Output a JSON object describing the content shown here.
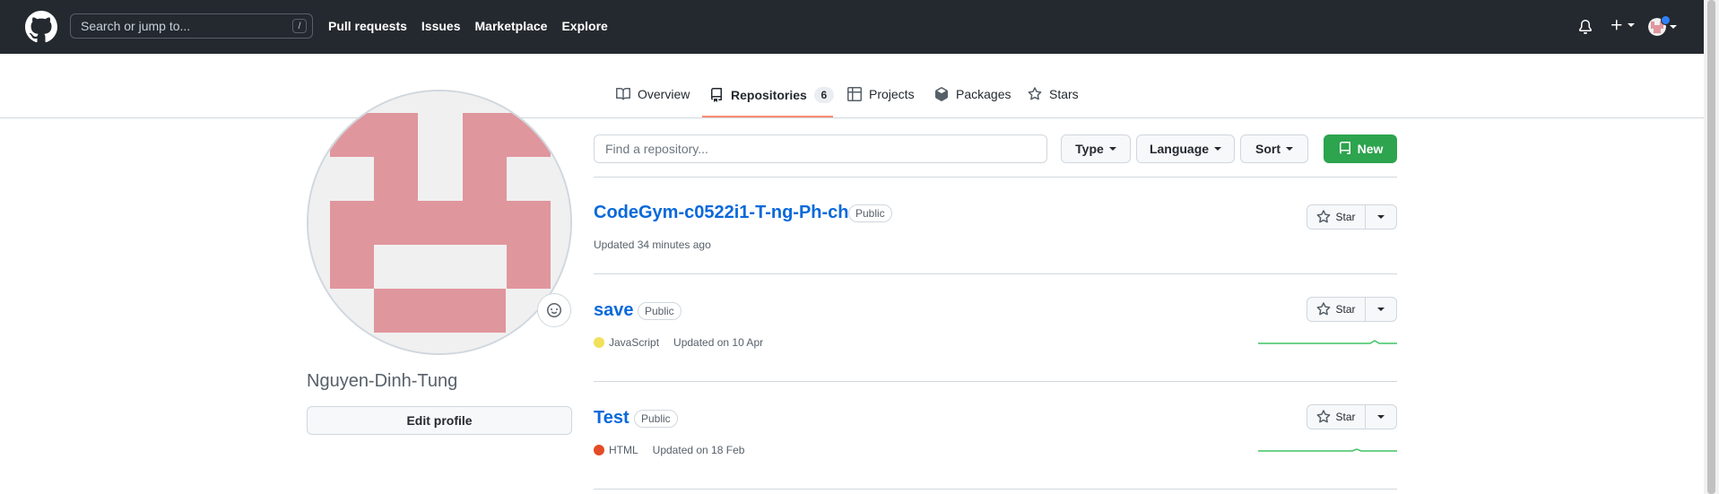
{
  "header": {
    "search_placeholder": "Search or jump to...",
    "search_key": "/",
    "nav": [
      "Pull requests",
      "Issues",
      "Marketplace",
      "Explore"
    ]
  },
  "tabs": {
    "overview": "Overview",
    "repositories": "Repositories",
    "repositories_count": "6",
    "projects": "Projects",
    "packages": "Packages",
    "stars": "Stars"
  },
  "profile": {
    "username": "Nguyen-Dinh-Tung",
    "edit_label": "Edit profile"
  },
  "filters": {
    "find_placeholder": "Find a repository...",
    "type": "Type",
    "language": "Language",
    "sort": "Sort",
    "new": "New"
  },
  "repos": [
    {
      "name": "CodeGym-c0522i1-T-ng-Ph-ch",
      "visibility": "Public",
      "language": "",
      "language_color": "",
      "updated": "Updated 34 minutes ago",
      "star_label": "Star"
    },
    {
      "name": "save",
      "visibility": "Public",
      "language": "JavaScript",
      "language_color": "#f1e05a",
      "updated": "Updated on 10 Apr",
      "star_label": "Star"
    },
    {
      "name": "Test",
      "visibility": "Public",
      "language": "HTML",
      "language_color": "#e34c26",
      "updated": "Updated on 18 Feb",
      "star_label": "Star"
    }
  ],
  "colors": {
    "header_bg": "#24292f",
    "link": "#0969da",
    "primary_button": "#2da44e",
    "avatar_pink": "#e0969d",
    "avatar_bg": "#f0f0f0",
    "tab_underline": "#fd8c73",
    "sparkline": "#40c463"
  }
}
